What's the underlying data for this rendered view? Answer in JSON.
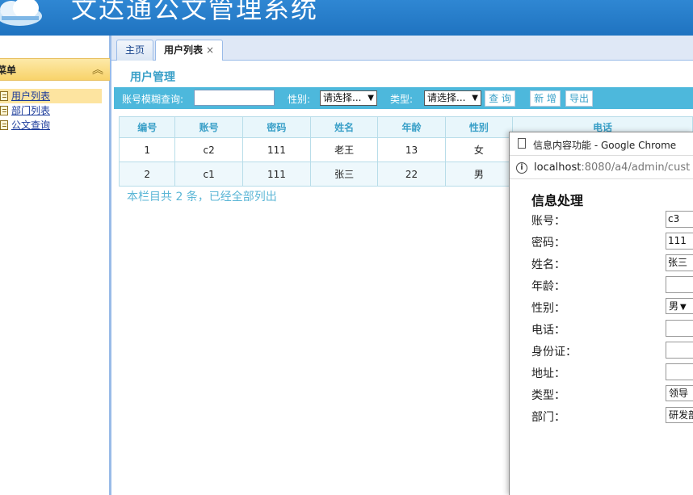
{
  "app": {
    "title": "文达通公文管理系统"
  },
  "sidebar": {
    "header": "菜单",
    "items": [
      {
        "label": "用户列表",
        "active": true
      },
      {
        "label": "部门列表",
        "active": false
      },
      {
        "label": "公文查询",
        "active": false
      }
    ]
  },
  "tabs": [
    {
      "label": "主页",
      "active": false
    },
    {
      "label": "用户列表",
      "active": true,
      "close": "×"
    }
  ],
  "main": {
    "section_title": "用户管理",
    "toolbar": {
      "account_search_label": "账号模糊查询:",
      "account_search_value": "",
      "gender_label": "性别:",
      "gender_selected": "请选择...",
      "type_label": "类型:",
      "type_selected": "请选择...",
      "query_button": "查 询",
      "add_button": "新 增",
      "export_button": "导出"
    },
    "table": {
      "columns": [
        "编号",
        "账号",
        "密码",
        "姓名",
        "年龄",
        "性别",
        "电话"
      ],
      "rows": [
        [
          "1",
          "c2",
          "111",
          "老王",
          "13",
          "女",
          ""
        ],
        [
          "2",
          "c1",
          "111",
          "张三",
          "22",
          "男",
          ""
        ]
      ]
    },
    "footer_note": "本栏目共 2 条，已经全部列出"
  },
  "popup": {
    "window_title": "信息内容功能 - Google Chrome",
    "url_host": "localhost",
    "url_rest": ":8080/a4/admin/cust",
    "info_icon": "i",
    "form_title": "信息处理",
    "fields": [
      {
        "label": "账号：",
        "value": "c3",
        "kind": "input"
      },
      {
        "label": "密码：",
        "value": "111",
        "kind": "input"
      },
      {
        "label": "姓名：",
        "value": "张三",
        "kind": "input"
      },
      {
        "label": "年龄：",
        "value": "",
        "kind": "input"
      },
      {
        "label": "性别：",
        "value": "男",
        "kind": "select"
      },
      {
        "label": "电话：",
        "value": "",
        "kind": "input"
      },
      {
        "label": "身份证：",
        "value": "",
        "kind": "input"
      },
      {
        "label": "地址：",
        "value": "",
        "kind": "input"
      },
      {
        "label": "类型：",
        "value": "领导",
        "kind": "select"
      },
      {
        "label": "部门：",
        "value": "研发部",
        "kind": "select"
      }
    ]
  },
  "icons": {
    "arrow": "▼",
    "collapse": "︽"
  }
}
